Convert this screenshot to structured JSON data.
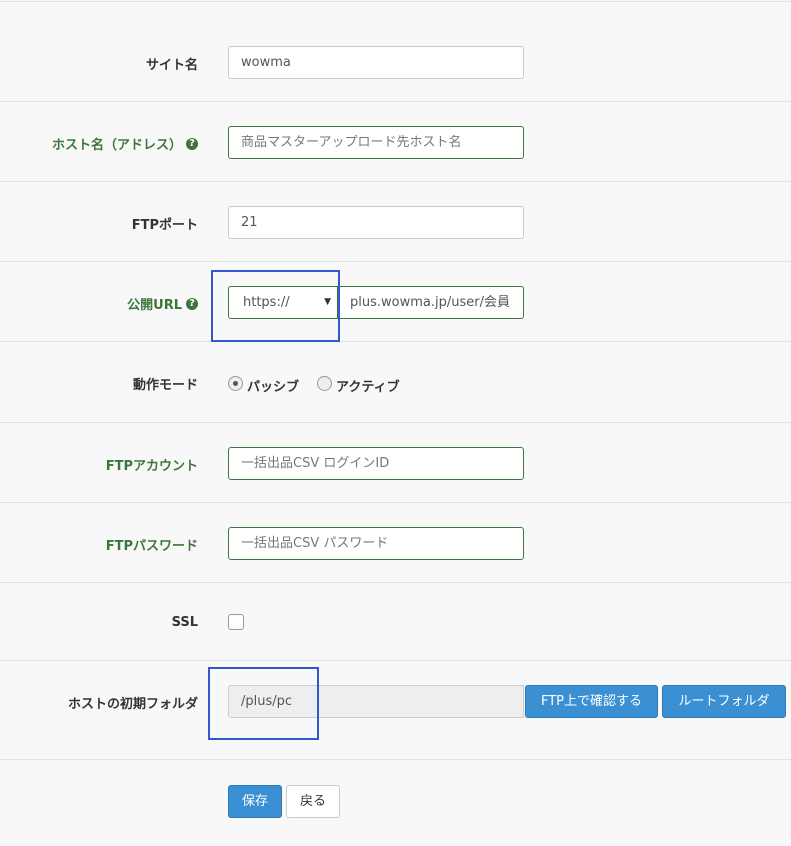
{
  "form": {
    "site_name": {
      "label": "サイト名",
      "value": "wowma"
    },
    "host_name": {
      "label": "ホスト名（アドレス）",
      "placeholder": "商品マスターアップロード先ホスト名"
    },
    "ftp_port": {
      "label": "FTPポート",
      "value": "21"
    },
    "public_url": {
      "label": "公開URL",
      "protocol": "https://",
      "value": "plus.wowma.jp/user/会員"
    },
    "mode": {
      "label": "動作モード",
      "options": [
        "パッシブ",
        "アクティブ"
      ],
      "selected": "パッシブ"
    },
    "ftp_account": {
      "label": "FTPアカウント",
      "placeholder": "一括出品CSV ログインID"
    },
    "ftp_password": {
      "label": "FTPパスワード",
      "placeholder": "一括出品CSV パスワード"
    },
    "ssl": {
      "label": "SSL",
      "checked": false
    },
    "initial_folder": {
      "label": "ホストの初期フォルダ",
      "value": "/plus/pc",
      "check_button": "FTP上で確認する",
      "root_button": "ルートフォルダ"
    }
  },
  "actions": {
    "save": "保存",
    "back": "戻る"
  },
  "help_icon": "question-circle-icon",
  "colors": {
    "accent": "#3a90d3",
    "valid": "#3c763d",
    "highlight": "#3457c9"
  }
}
